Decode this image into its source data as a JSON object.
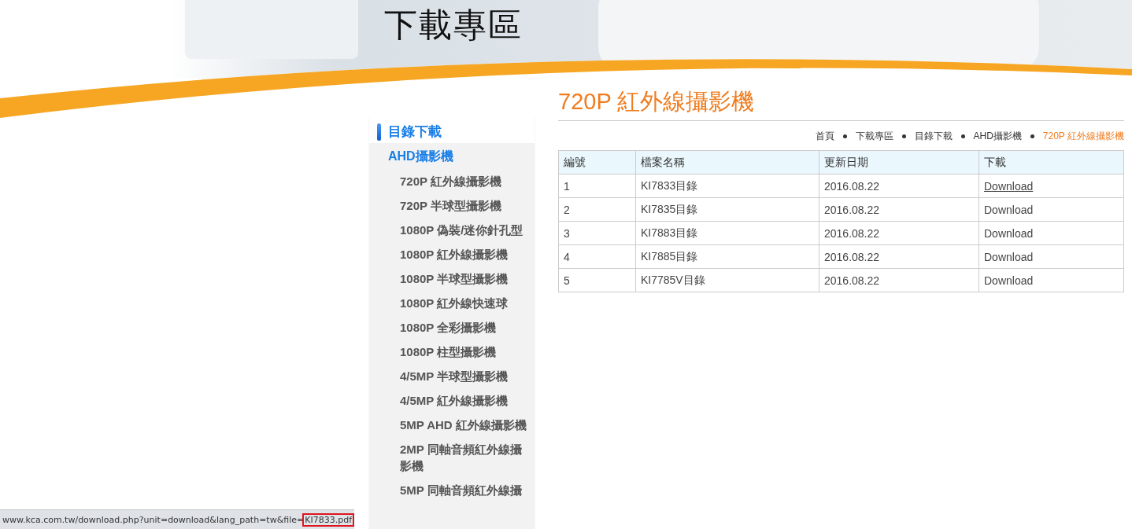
{
  "header": {
    "title": "下載專區"
  },
  "sidebar": {
    "heading": "目錄下載",
    "items": [
      {
        "label": "AHD攝影機",
        "children": [
          {
            "label": "720P 紅外線攝影機"
          },
          {
            "label": "720P 半球型攝影機"
          },
          {
            "label": "1080P 偽裝/迷你針孔型"
          },
          {
            "label": "1080P 紅外線攝影機"
          },
          {
            "label": "1080P 半球型攝影機"
          },
          {
            "label": "1080P 紅外線快速球"
          },
          {
            "label": "1080P 全彩攝影機"
          },
          {
            "label": "1080P 柱型攝影機"
          },
          {
            "label": "4/5MP 半球型攝影機"
          },
          {
            "label": "4/5MP 紅外線攝影機"
          },
          {
            "label": "5MP AHD 紅外線攝影機"
          },
          {
            "label": "2MP 同軸音頻紅外線攝影機"
          },
          {
            "label": "5MP 同軸音頻紅外線攝"
          }
        ]
      }
    ]
  },
  "page_title": "720P 紅外線攝影機",
  "breadcrumb": [
    {
      "label": "首頁",
      "current": false
    },
    {
      "label": "下載專區",
      "current": false
    },
    {
      "label": "目錄下載",
      "current": false
    },
    {
      "label": "AHD攝影機",
      "current": false
    },
    {
      "label": "720P 紅外線攝影機",
      "current": true
    }
  ],
  "table": {
    "columns": [
      "編號",
      "檔案名稱",
      "更新日期",
      "下載"
    ],
    "rows": [
      {
        "number": "1",
        "file": "KI7833目錄",
        "date": "2016.08.22",
        "link": "Download",
        "hovered": true
      },
      {
        "number": "2",
        "file": "KI7835目錄",
        "date": "2016.08.22",
        "link": "Download",
        "hovered": false
      },
      {
        "number": "3",
        "file": "KI7883目錄",
        "date": "2016.08.22",
        "link": "Download",
        "hovered": false
      },
      {
        "number": "4",
        "file": "KI7885目錄",
        "date": "2016.08.22",
        "link": "Download",
        "hovered": false
      },
      {
        "number": "5",
        "file": "KI7785V目錄",
        "date": "2016.08.22",
        "link": "Download",
        "hovered": false
      }
    ]
  },
  "status_bar": {
    "text": "www.kca.com.tw/download.php?unit=download&lang_path=tw&file=",
    "highlighted": "KI7833.pdf"
  }
}
